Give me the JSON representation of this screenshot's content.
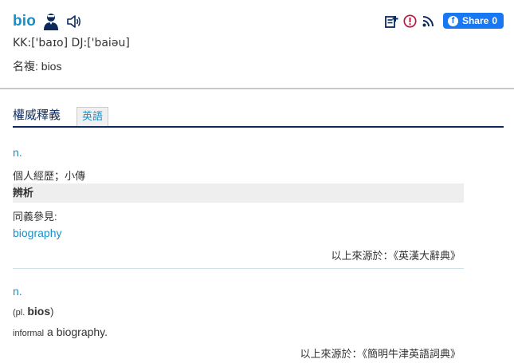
{
  "header": {
    "word": "bio",
    "phonetic": "KK:['baɪo] DJ:['baiəu]",
    "plural": "名複: bios",
    "share_label": "Share",
    "share_count": "0"
  },
  "icons": {
    "pronunciation_person": "person-icon",
    "speaker": "speaker-icon",
    "add_to_list": "add-list-icon",
    "report": "report-icon",
    "rss": "rss-icon",
    "facebook": "facebook-icon"
  },
  "tabs": {
    "active": "權威釋義",
    "english": "英語"
  },
  "entries": [
    {
      "pos": "n.",
      "definition": "個人經歷；小傳",
      "analysis_label": "辨析",
      "synonym_label": "同義參見:",
      "synonym_link": "biography",
      "source": "以上來源於：《英漢大辭典》"
    },
    {
      "pos": "n.",
      "plural_prefix": "(pl. ",
      "plural_word": "bios",
      "plural_suffix": ")",
      "register": "informal",
      "definition": " a biography.",
      "source": "以上來源於：《簡明牛津英語詞典》"
    }
  ],
  "colors": {
    "accent": "#1a8fc6",
    "navy": "#0c2a5e",
    "facebook": "#1877f2"
  }
}
